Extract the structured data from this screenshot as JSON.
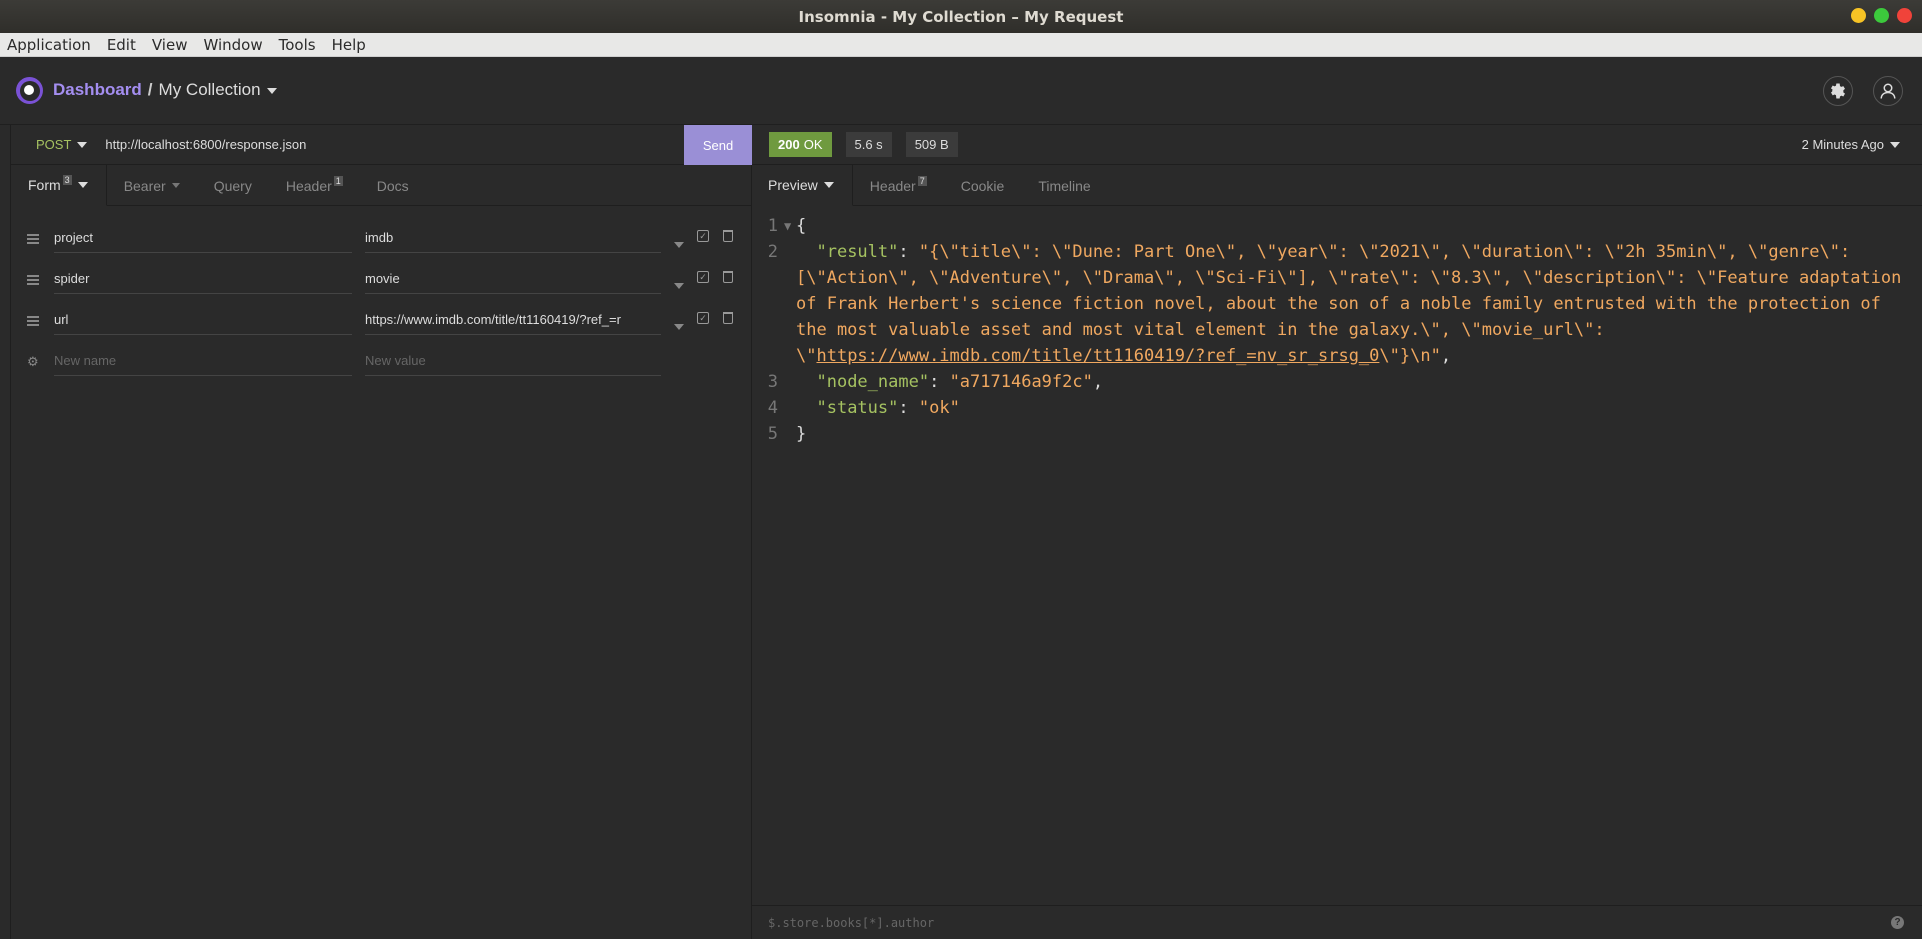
{
  "window": {
    "title": "Insomnia - My Collection – My Request"
  },
  "menu": [
    "Application",
    "Edit",
    "View",
    "Window",
    "Tools",
    "Help"
  ],
  "header": {
    "dashboard": "Dashboard",
    "separator": "/",
    "collection": "My Collection"
  },
  "request": {
    "method": "POST",
    "url": "http://localhost:6800/response.json",
    "send_label": "Send",
    "tabs": [
      {
        "label": "Form",
        "badge": "3"
      },
      {
        "label": "Bearer",
        "badge": ""
      },
      {
        "label": "Query",
        "badge": ""
      },
      {
        "label": "Header",
        "badge": "1"
      },
      {
        "label": "Docs",
        "badge": ""
      }
    ],
    "params": [
      {
        "name": "project",
        "value": "imdb"
      },
      {
        "name": "spider",
        "value": "movie"
      },
      {
        "name": "url",
        "value": "https://www.imdb.com/title/tt1160419/?ref_=r"
      }
    ],
    "new_name_placeholder": "New name",
    "new_value_placeholder": "New value"
  },
  "response": {
    "status_code": "200",
    "status_text": "OK",
    "time": "5.6 s",
    "size": "509 B",
    "ago": "2 Minutes Ago",
    "tabs": [
      {
        "label": "Preview",
        "badge": ""
      },
      {
        "label": "Header",
        "badge": "7"
      },
      {
        "label": "Cookie",
        "badge": ""
      },
      {
        "label": "Timeline",
        "badge": ""
      }
    ],
    "lines": [
      "1",
      "2",
      "3",
      "4",
      "5"
    ],
    "body": {
      "open": "{",
      "result_key": "\"result\"",
      "result_value_a": "\"{\\\"title\\\": \\\"Dune: Part One\\\", \\\"year\\\": \\\"2021\\\", \\\"duration\\\": \\\"2h 35min\\\", \\\"genre\\\": [\\\"Action\\\", \\\"Adventure\\\", \\\"Drama\\\", \\\"Sci-Fi\\\"], \\\"rate\\\": \\\"8.3\\\", \\\"description\\\": \\\"Feature adaptation of Frank Herbert's science fiction novel, about the son of a noble family entrusted with the protection of the most valuable asset and most vital element in the galaxy.\\\", \\\"movie_url\\\": \\\"",
      "result_link": "https://www.imdb.com/title/tt1160419/?ref_=nv_sr_srsg_0",
      "result_value_b": "\\\"}\\n\"",
      "node_key": "\"node_name\"",
      "node_value": "\"a717146a9f2c\"",
      "status_key": "\"status\"",
      "status_value": "\"ok\"",
      "close": "}"
    },
    "filter_placeholder": "$.store.books[*].author"
  }
}
